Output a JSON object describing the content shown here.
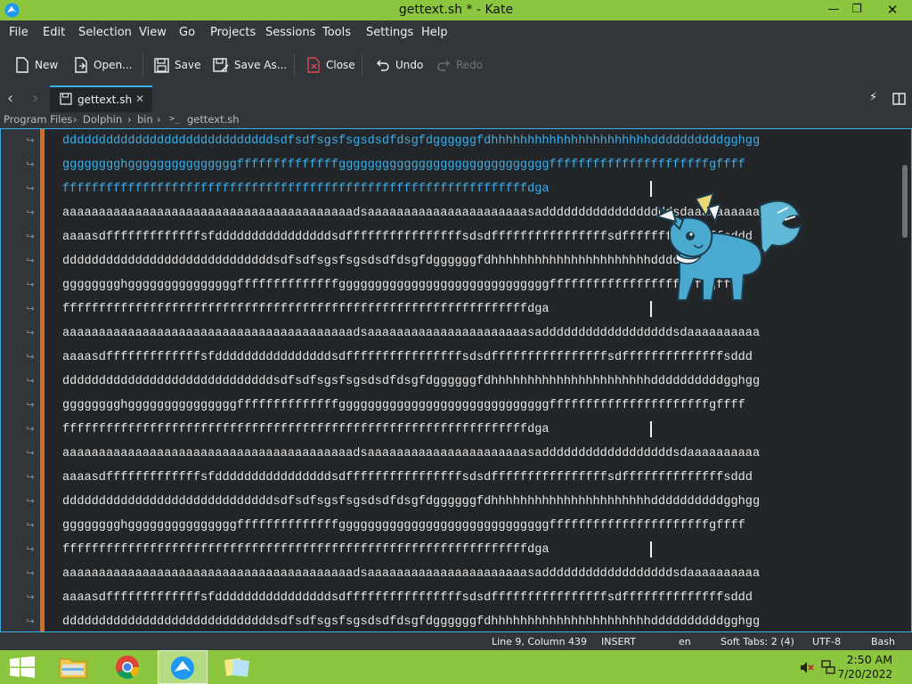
{
  "window": {
    "title": "gettext.sh * - Kate"
  },
  "menu": [
    "File",
    "Edit",
    "Selection",
    "View",
    "Go",
    "Projects",
    "Sessions",
    "Tools",
    "Settings",
    "Help"
  ],
  "toolbar": {
    "new": "New",
    "open": "Open...",
    "save": "Save",
    "save_as": "Save As...",
    "close": "Close",
    "undo": "Undo",
    "redo": "Redo"
  },
  "tab": {
    "label": "gettext.sh"
  },
  "breadcrumb": [
    "Program Files",
    "Dolphin",
    "bin",
    "gettext.sh"
  ],
  "editor": {
    "lines": [
      "dddddddddddddddddddddddddddddsdfsdfsgsfsgsdsdfdsgfdggggggfdhhhhhhhhhhhhhhhhhhhhhhddddddddddgghgg",
      "gggggggghgggggggggggggggffffffffffffffgggggggggggggggggggggggggggggffffffffffffffffffffffgffff",
      "ffffffffffffffffffffffffffffffffffffffffffffffffffffffffffffffffdga",
      "aaaaaaaaaaaaaaaaaaaaaaaaaaaaaaaaaaaaaaaadsaaaaaaaaaaaaaaaaaaaaaasaddddddddddddddddddsdaaaaaaaaaa",
      "aaaasdfffffffffffffsfddddddddddddddddsdffffffffffffffffsdsdffffffffffffffffsdffffffffffffffsddd",
      "dddddddddddddddddddddddddddddsdfsdfsgsfsgsdsdfdsgfdggggggfdhhhhhhhhhhhhhhhhhhhhhhddddddddddgghgg",
      "gggggggghgggggggggggggggffffffffffffffgggggggggggggggggggggggggggggffffffffffffffffffffffgffff",
      "ffffffffffffffffffffffffffffffffffffffffffffffffffffffffffffffffdga",
      "aaaaaaaaaaaaaaaaaaaaaaaaaaaaaaaaaaaaaaaadsaaaaaaaaaaaaaaaaaaaaaasaddddddddddddddddddsdaaaaaaaaaa",
      "aaaasdfffffffffffffsfddddddddddddddddsdffffffffffffffffsdsdffffffffffffffffsdffffffffffffffsddd",
      "dddddddddddddddddddddddddddddsdfsdfsgsfsgsdsdfdsgfdggggggfdhhhhhhhhhhhhhhhhhhhhhhddddddddddgghgg",
      "gggggggghgggggggggggggggffffffffffffffgggggggggggggggggggggggggggggffffffffffffffffffffffgffff",
      "ffffffffffffffffffffffffffffffffffffffffffffffffffffffffffffffffdga",
      "aaaaaaaaaaaaaaaaaaaaaaaaaaaaaaaaaaaaaaaadsaaaaaaaaaaaaaaaaaaaaaasaddddddddddddddddddsdaaaaaaaaaa",
      "aaaasdfffffffffffffsfddddddddddddddddsdffffffffffffffffsdsdffffffffffffffffsdffffffffffffffsddd",
      "dddddddddddddddddddddddddddddsdfsdfsgsfsgsdsdfdsgfdggggggfdhhhhhhhhhhhhhhhhhhhhhhddddddddddgghgg",
      "gggggggghgggggggggggggggffffffffffffffgggggggggggggggggggggggggggggffffffffffffffffffffffgffff",
      "ffffffffffffffffffffffffffffffffffffffffffffffffffffffffffffffffdga",
      "aaaaaaaaaaaaaaaaaaaaaaaaaaaaaaaaaaaaaaaadsaaaaaaaaaaaaaaaaaaaaaasaddddddddddddddddddsdaaaaaaaaaa",
      "aaaasdfffffffffffffsfddddddddddddddddsdffffffffffffffffsdsdffffffffffffffffsdffffffffffffffsddd",
      "dddddddddddddddddddddddddddddsdfsdfsgsfsgsdsdfdsgfdggggggfdhhhhhhhhhhhhhhhhhhhhhhddddddddddgghgg"
    ],
    "selected_line_count": 3
  },
  "status": {
    "position": "Line 9, Column 439",
    "mode": "INSERT",
    "language": "en",
    "indent": "Soft Tabs: 2 (4)",
    "encoding": "UTF-8",
    "syntax": "Bash"
  },
  "taskbar": {
    "time": "2:50 AM",
    "date": "7/20/2022"
  },
  "colors": {
    "accent": "#3daee9",
    "window_chrome": "#8cc63f",
    "fold_marker": "#da6a1e",
    "editor_bg": "#232629"
  }
}
